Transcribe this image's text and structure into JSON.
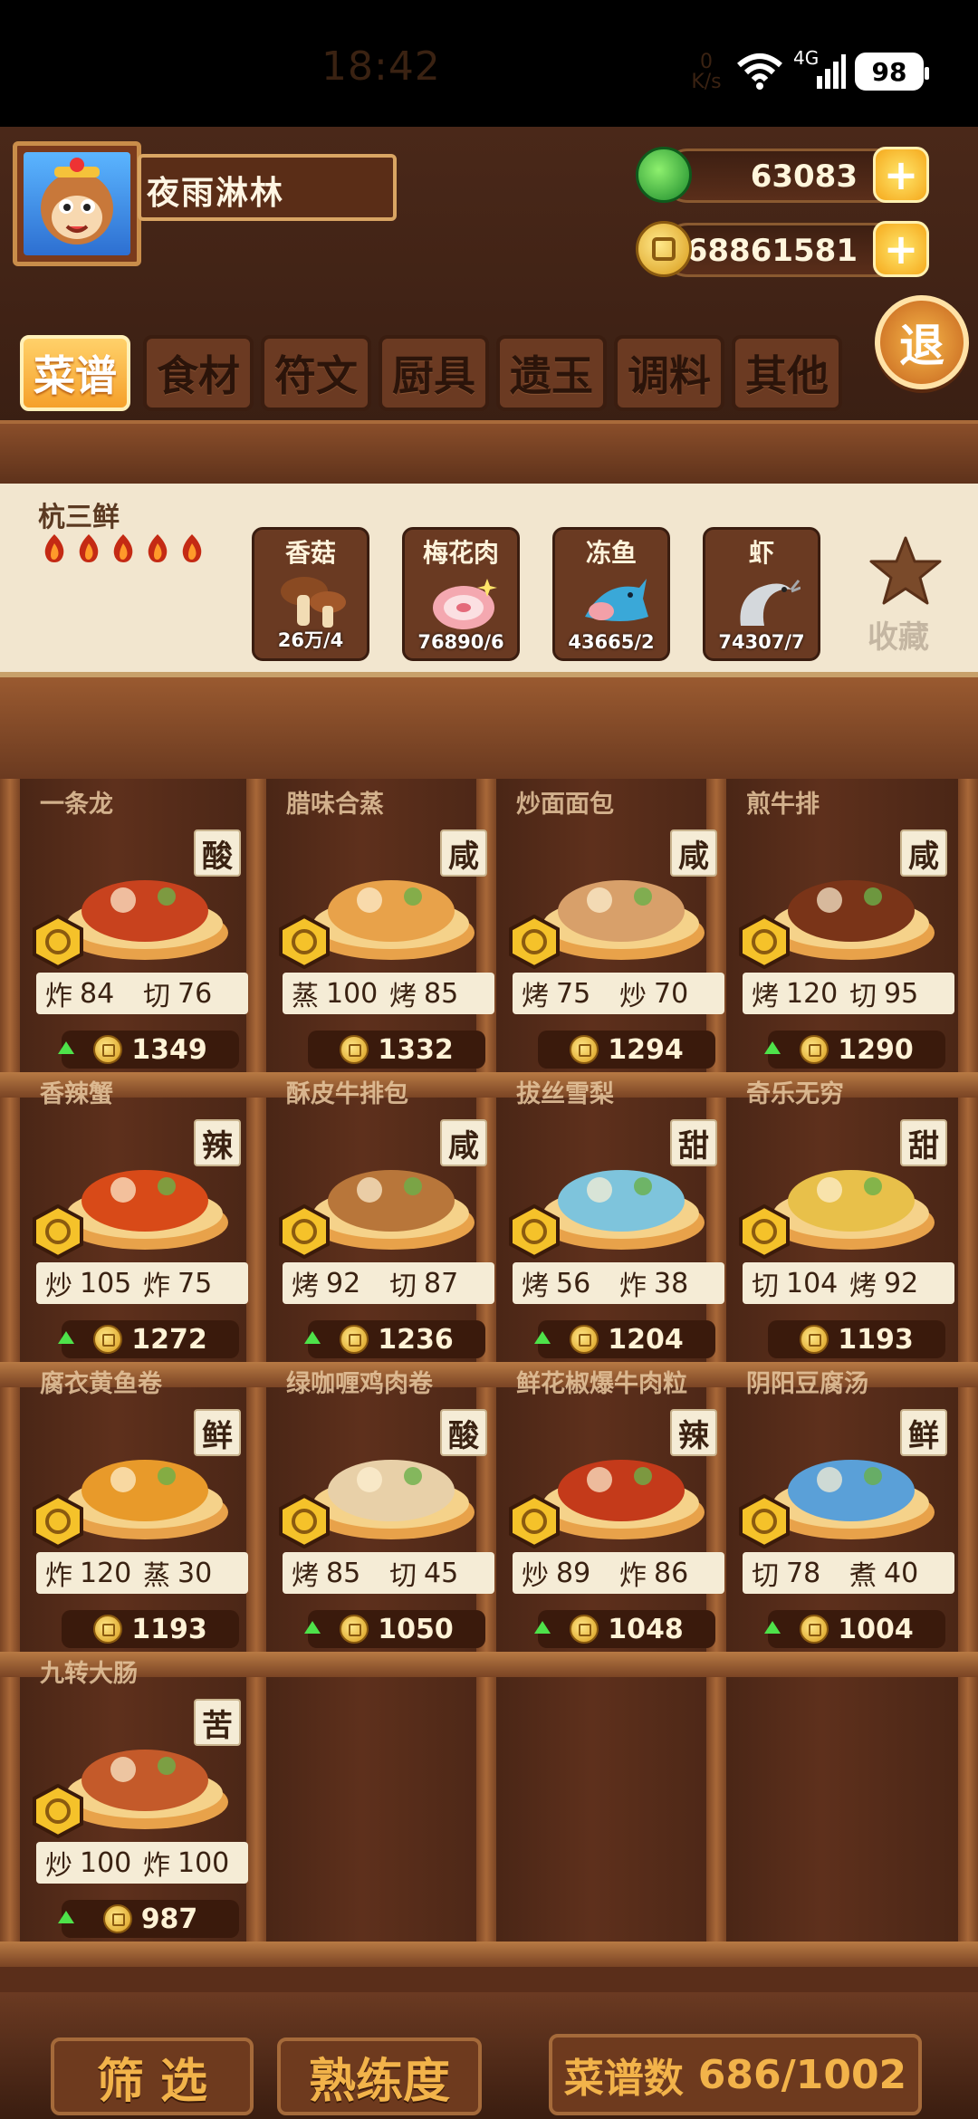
{
  "status_bar": {
    "time": "18:42",
    "net_speed_top": "0",
    "net_speed_bottom": "K/s",
    "network": "4G",
    "battery": "98"
  },
  "player": {
    "name": "夜雨淋林"
  },
  "currency": {
    "jade": "63083",
    "coins": "68861581"
  },
  "exit_label": "退",
  "tabs": [
    {
      "label": "菜谱",
      "active": true
    },
    {
      "label": "食材",
      "active": false
    },
    {
      "label": "符文",
      "active": false
    },
    {
      "label": "厨具",
      "active": false
    },
    {
      "label": "遗玉",
      "active": false
    },
    {
      "label": "调料",
      "active": false
    },
    {
      "label": "其他",
      "active": false
    }
  ],
  "selected_recipe": {
    "name": "杭三鲜",
    "stars": 5,
    "ingredients": [
      {
        "name": "香菇",
        "count": "26万/4",
        "icon": "mushroom-icon"
      },
      {
        "name": "梅花肉",
        "count": "76890/6",
        "icon": "pork-icon"
      },
      {
        "name": "冻鱼",
        "count": "43665/2",
        "icon": "fish-icon"
      },
      {
        "name": "虾",
        "count": "74307/7",
        "icon": "shrimp-icon"
      }
    ],
    "favorite_label": "收藏"
  },
  "recipes": [
    {
      "name": "一条龙",
      "taste": "酸",
      "skills": [
        [
          "炸",
          "84"
        ],
        [
          "切",
          "76"
        ]
      ],
      "price": "1349",
      "up": true
    },
    {
      "name": "腊味合蒸",
      "taste": "咸",
      "skills": [
        [
          "蒸",
          "100"
        ],
        [
          "烤",
          "85"
        ]
      ],
      "price": "1332",
      "up": false
    },
    {
      "name": "炒面面包",
      "taste": "咸",
      "skills": [
        [
          "烤",
          "75"
        ],
        [
          "炒",
          "70"
        ]
      ],
      "price": "1294",
      "up": false
    },
    {
      "name": "煎牛排",
      "taste": "咸",
      "skills": [
        [
          "烤",
          "120"
        ],
        [
          "切",
          "95"
        ]
      ],
      "price": "1290",
      "up": true
    },
    {
      "name": "香辣蟹",
      "taste": "辣",
      "skills": [
        [
          "炒",
          "105"
        ],
        [
          "炸",
          "75"
        ]
      ],
      "price": "1272",
      "up": true
    },
    {
      "name": "酥皮牛排包",
      "taste": "咸",
      "skills": [
        [
          "烤",
          "92"
        ],
        [
          "切",
          "87"
        ]
      ],
      "price": "1236",
      "up": true
    },
    {
      "name": "拔丝雪梨",
      "taste": "甜",
      "skills": [
        [
          "烤",
          "56"
        ],
        [
          "炸",
          "38"
        ]
      ],
      "price": "1204",
      "up": true
    },
    {
      "name": "奇乐无穷",
      "taste": "甜",
      "skills": [
        [
          "切",
          "104"
        ],
        [
          "烤",
          "92"
        ]
      ],
      "price": "1193",
      "up": false
    },
    {
      "name": "腐衣黄鱼卷",
      "taste": "鲜",
      "skills": [
        [
          "炸",
          "120"
        ],
        [
          "蒸",
          "30"
        ]
      ],
      "price": "1193",
      "up": false
    },
    {
      "name": "绿咖喱鸡肉卷",
      "taste": "酸",
      "skills": [
        [
          "烤",
          "85"
        ],
        [
          "切",
          "45"
        ]
      ],
      "price": "1050",
      "up": true
    },
    {
      "name": "鲜花椒爆牛肉粒",
      "taste": "辣",
      "skills": [
        [
          "炒",
          "89"
        ],
        [
          "炸",
          "86"
        ]
      ],
      "price": "1048",
      "up": true
    },
    {
      "name": "阴阳豆腐汤",
      "taste": "鲜",
      "skills": [
        [
          "切",
          "78"
        ],
        [
          "煮",
          "40"
        ]
      ],
      "price": "1004",
      "up": true
    },
    {
      "name": "九转大肠",
      "taste": "苦",
      "skills": [
        [
          "炒",
          "100"
        ],
        [
          "炸",
          "100"
        ]
      ],
      "price": "987",
      "up": true
    }
  ],
  "bottom": {
    "filter_label": "筛 选",
    "proficiency_label": "熟练度",
    "count_label": "菜谱数",
    "count_value": "686/1002"
  },
  "colors": {
    "accent": "#f5a02a",
    "wood_dark": "#3a1d10",
    "panel": "#f2e6cf",
    "price_up": "#4ee24a"
  }
}
